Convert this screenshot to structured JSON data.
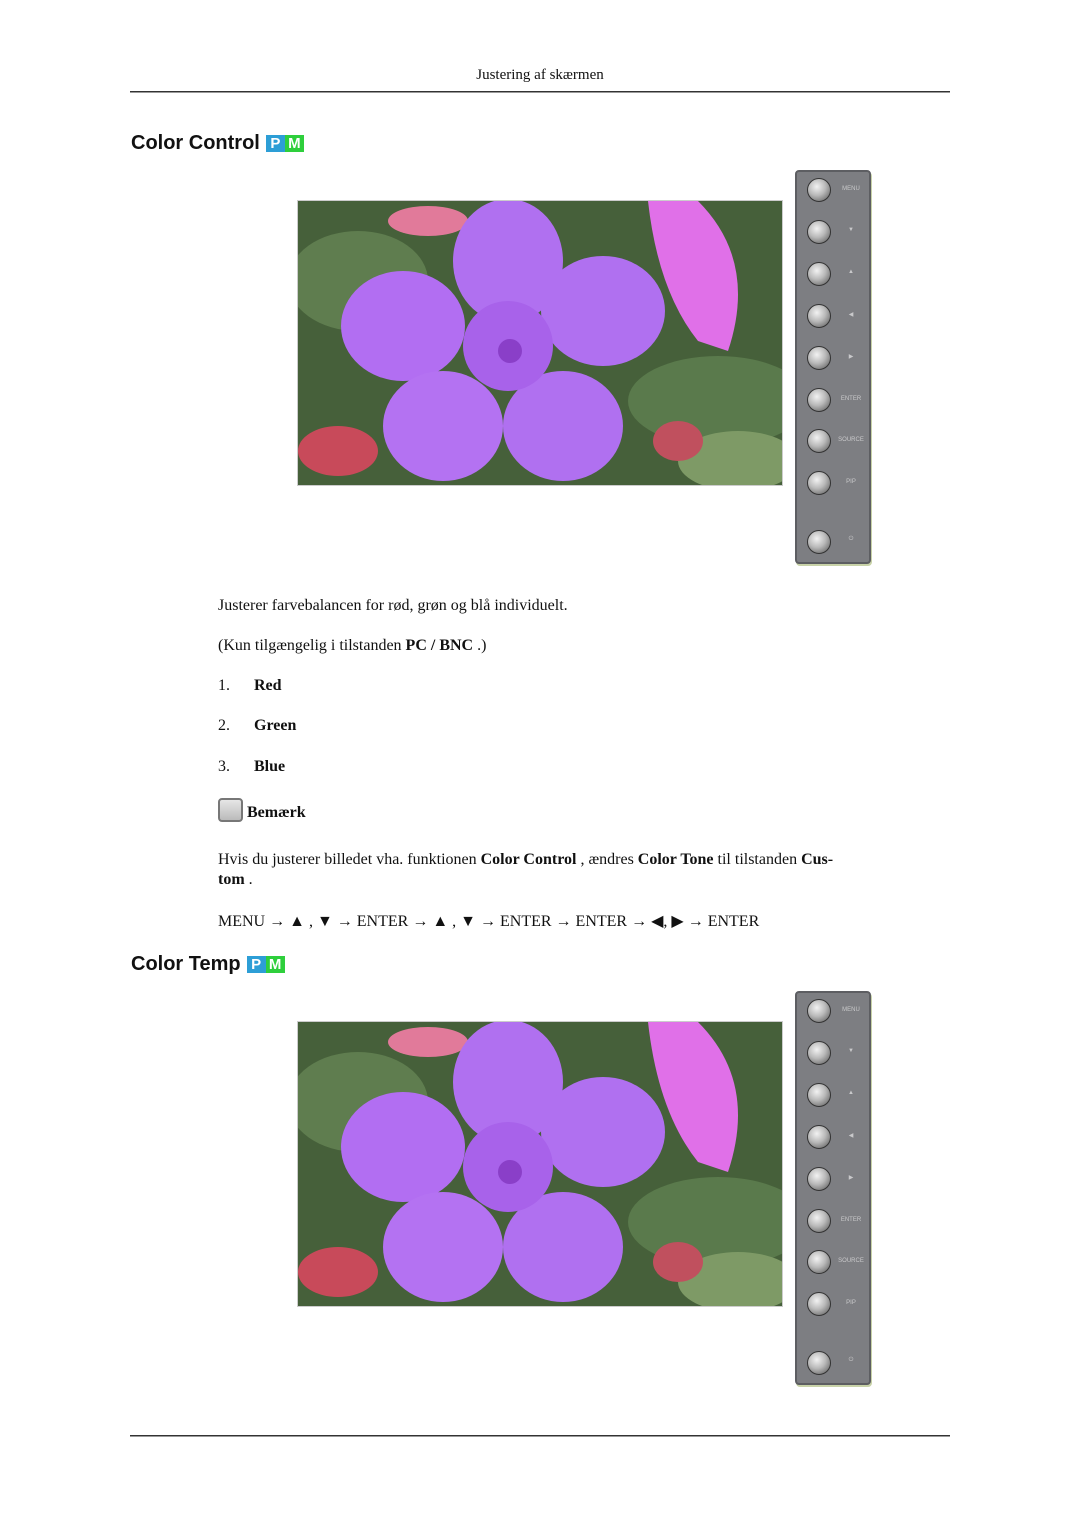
{
  "header": {
    "title": "Justering af skærmen"
  },
  "badge": {
    "p": "P",
    "m": "M"
  },
  "sections": [
    {
      "title": "Color Control"
    },
    {
      "title": "Color Temp"
    }
  ],
  "panel_buttons": [
    {
      "label": "MENU",
      "icon": "menu"
    },
    {
      "label": "▼",
      "icon": "down-arrow"
    },
    {
      "label": "▲",
      "icon": "up-arrow"
    },
    {
      "label": "◀",
      "icon": "left-arrow"
    },
    {
      "label": "▶",
      "icon": "right-arrow"
    },
    {
      "label": "ENTER",
      "icon": "enter"
    },
    {
      "label": "SOURCE",
      "icon": "source"
    },
    {
      "label": "PIP",
      "icon": "pip"
    },
    {
      "label": "⏻",
      "icon": "power"
    }
  ],
  "color_control": {
    "description": "Justerer farvebalancen for rød, grøn og blå individuelt.",
    "availability_prefix": "(Kun tilgængelig i tilstanden ",
    "availability_mode": "PC / BNC",
    "availability_suffix": " .)",
    "items": [
      {
        "num": "1.",
        "label": "Red"
      },
      {
        "num": "2.",
        "label": "Green"
      },
      {
        "num": "3.",
        "label": "Blue"
      }
    ],
    "note_label": "Bemærk",
    "note": {
      "t1": "Hvis du justerer billedet vha. funktionen ",
      "b1": "Color Control",
      "t2": " , ændres ",
      "b2": "Color Tone",
      "t3": " til tilstanden ",
      "b3": "Cus-",
      "b4": "tom",
      "t4": " ."
    },
    "nav_path": "MENU → ▲ , ▼ → ENTER → ▲ , ▼ → ENTER → ENTER → ◀, ▶ → ENTER"
  }
}
